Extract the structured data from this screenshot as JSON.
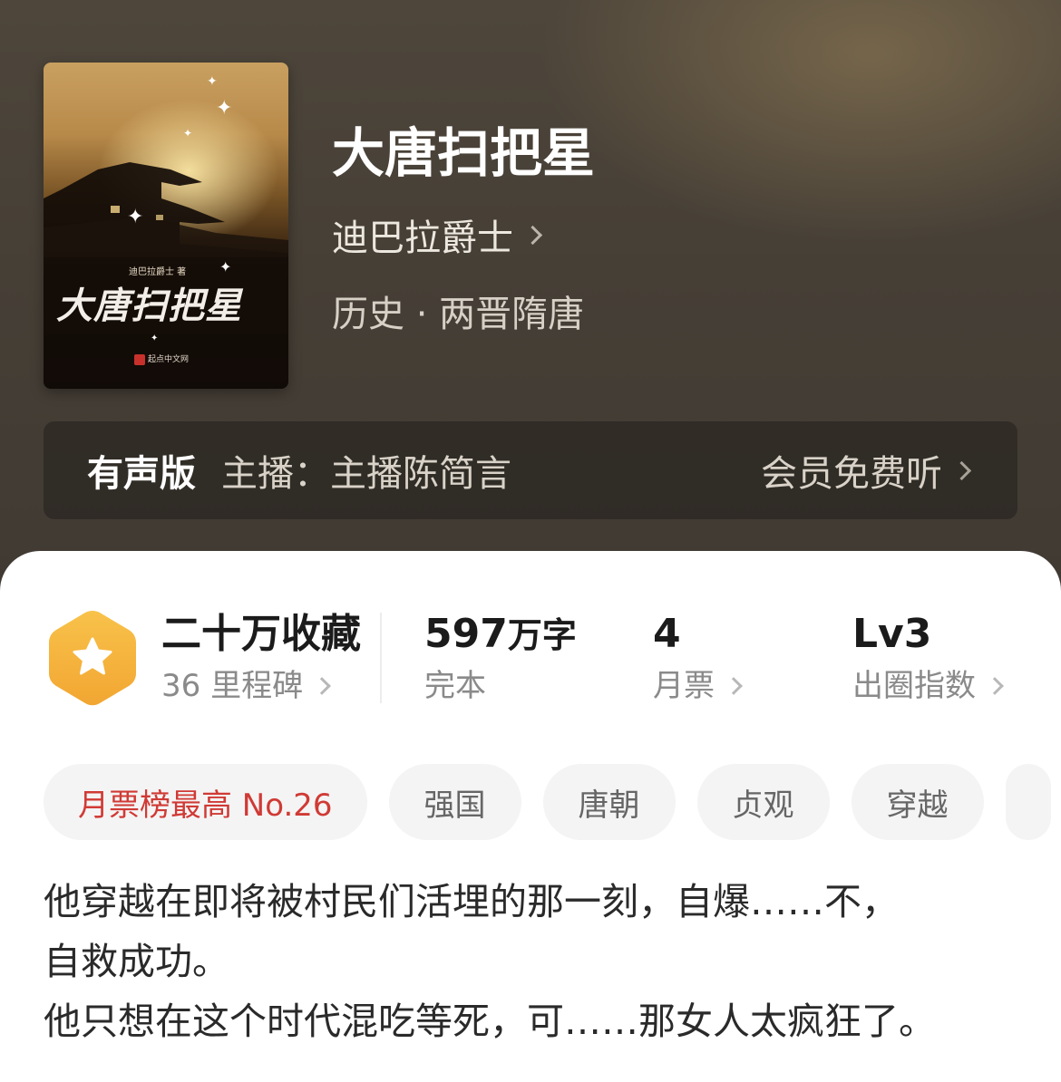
{
  "book": {
    "title": "大唐扫把星",
    "author": "迪巴拉爵士",
    "category": "历史 · 两晋隋唐"
  },
  "cover": {
    "author_line": "迪巴拉爵士 著",
    "title": "大唐扫把星",
    "publisher": "起点中文网"
  },
  "audio": {
    "label": "有声版",
    "host": "主播：主播陈简言",
    "action": "会员免费听"
  },
  "stats": {
    "collection": {
      "value": "二十万收藏",
      "sub": "36 里程碑"
    },
    "words": {
      "value": "597",
      "unit": "万字",
      "sub": "完本"
    },
    "monthly_ticket": {
      "value": "4",
      "sub": "月票"
    },
    "influence": {
      "value": "Lv3",
      "sub": "出圈指数"
    }
  },
  "tags": [
    "月票榜最高 No.26",
    "强国",
    "唐朝",
    "贞观",
    "穿越"
  ],
  "intro": [
    "他穿越在即将被村民们活埋的那一刻，自爆……不，",
    "自救成功。",
    "他只想在这个时代混吃等死，可……那女人太疯狂了。"
  ],
  "colors": {
    "accent_red": "#d03a35",
    "badge_orange": "#f5b93a"
  }
}
